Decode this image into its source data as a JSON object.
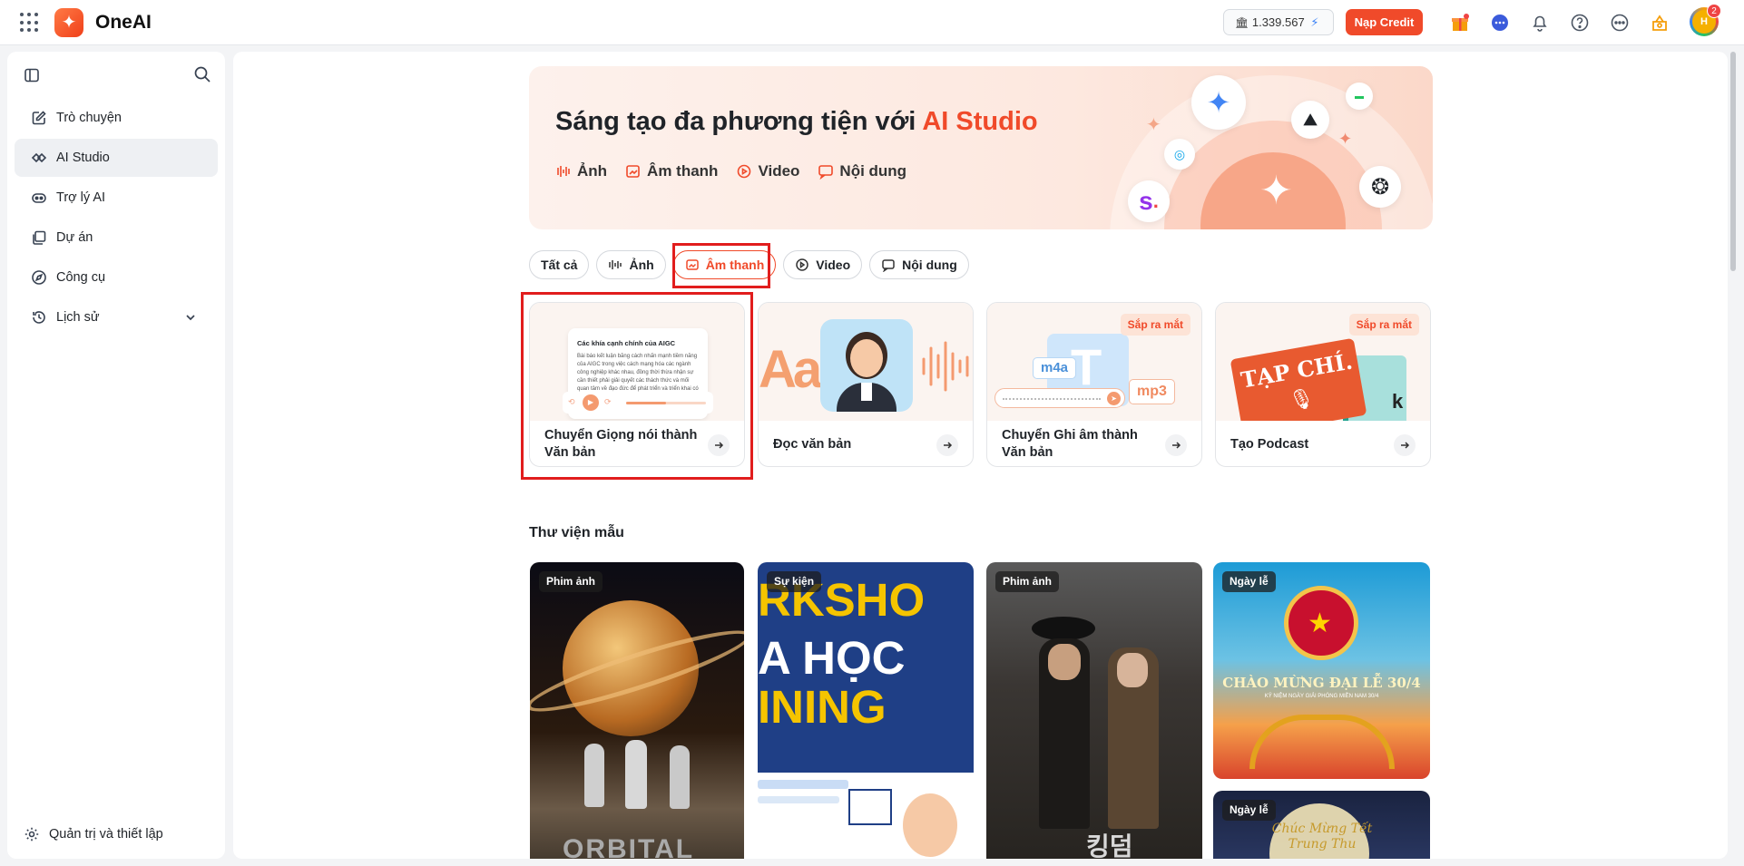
{
  "app": {
    "name": "OneAI"
  },
  "topbar": {
    "credit_value": "1.339.567",
    "topup_label": "Nạp Credit",
    "avatar_initials": "H",
    "notification_count": "2"
  },
  "sidebar": {
    "items": [
      {
        "label": "Trò chuyện",
        "icon": "edit-icon"
      },
      {
        "label": "AI Studio",
        "icon": "studio-icon"
      },
      {
        "label": "Trợ lý AI",
        "icon": "bot-icon"
      },
      {
        "label": "Dự án",
        "icon": "folder-icon"
      },
      {
        "label": "Công cụ",
        "icon": "compass-icon"
      },
      {
        "label": "Lịch sử",
        "icon": "history-icon"
      }
    ],
    "settings_label": "Quản trị và thiết lập"
  },
  "hero": {
    "title_prefix": "Sáng tạo đa phương tiện với ",
    "title_accent": "AI Studio",
    "tabs": [
      "Ảnh",
      "Âm thanh",
      "Video",
      "Nội dung"
    ]
  },
  "filters": [
    "Tất cả",
    "Ảnh",
    "Âm thanh",
    "Video",
    "Nội dung"
  ],
  "active_filter": "Âm thanh",
  "tool_cards": [
    {
      "label": "Chuyển Giọng nói thành Văn bản",
      "badge": ""
    },
    {
      "label": "Đọc văn bản",
      "badge": ""
    },
    {
      "label": "Chuyển Ghi âm thành Văn bản",
      "badge": "Sắp ra mắt"
    },
    {
      "label": "Tạo Podcast",
      "badge": "Sắp ra mắt"
    }
  ],
  "card1_preview": {
    "title": "Các khía cạnh chính của AIGC",
    "body": "Bài báo kết luận bằng cách nhấn mạnh tiềm năng của AIGC trong việc cách mạng hóa các ngành công nghiệp khác nhau, đồng thời thừa nhận sự cần thiết phải giải quyết các thách thức và mối quan tâm về đạo đức để phát triển và triển khai có trách nhiệm."
  },
  "card3_preview": {
    "chip1": "m4a",
    "chip2": "mp3"
  },
  "card4_preview": {
    "magazine": "TẠP CHÍ.",
    "book_letter": "k"
  },
  "card2_preview": {
    "letters": "Aa"
  },
  "library": {
    "title": "Thư viện mẫu",
    "templates": [
      {
        "tag": "Phim ảnh",
        "caption": "ORBITAL"
      },
      {
        "tag": "Sự kiện",
        "lines": [
          "RKSHO",
          "A HỌC",
          "INING"
        ]
      },
      {
        "tag": "Phim ảnh",
        "caption": "킹덤"
      },
      {
        "tag": "Ngày lễ",
        "caption": "CHÀO MỪNG ĐẠI LỄ 30/4",
        "subcaption": "KỶ NIỆM NGÀY GIẢI PHÓNG MIỀN NAM 30/4"
      },
      {
        "tag": "Ngày lễ",
        "caption": "Chúc Mừng Tết Trung Thu"
      }
    ]
  },
  "colors": {
    "accent": "#f04a2a",
    "highlight": "#e11d1d"
  }
}
